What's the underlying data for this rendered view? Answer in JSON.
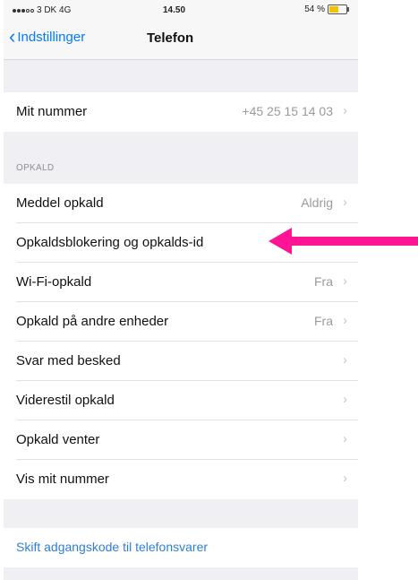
{
  "status_bar": {
    "carrier": "3 DK 4G",
    "time": "14.50",
    "battery": "54 %"
  },
  "nav": {
    "back_label": "Indstillinger",
    "title": "Telefon"
  },
  "my_number": {
    "label": "Mit nummer",
    "value": "+45 25 15 14 03"
  },
  "opkald_section": {
    "header": "OPKALD",
    "rows": [
      {
        "label": "Meddel opkald",
        "value": "Aldrig"
      },
      {
        "label": "Opkaldsblokering og opkalds-id",
        "value": ""
      },
      {
        "label": "Wi-Fi-opkald",
        "value": "Fra"
      },
      {
        "label": "Opkald på andre enheder",
        "value": "Fra"
      },
      {
        "label": "Svar med besked",
        "value": ""
      },
      {
        "label": "Viderestil opkald",
        "value": ""
      },
      {
        "label": "Opkald venter",
        "value": ""
      },
      {
        "label": "Vis mit nummer",
        "value": ""
      }
    ]
  },
  "voicemail": {
    "label": "Skift adgangskode til telefonsvarer"
  },
  "colors": {
    "accent": "#007aff",
    "annotation_arrow": "#ff1493",
    "battery": "#f2c200"
  }
}
